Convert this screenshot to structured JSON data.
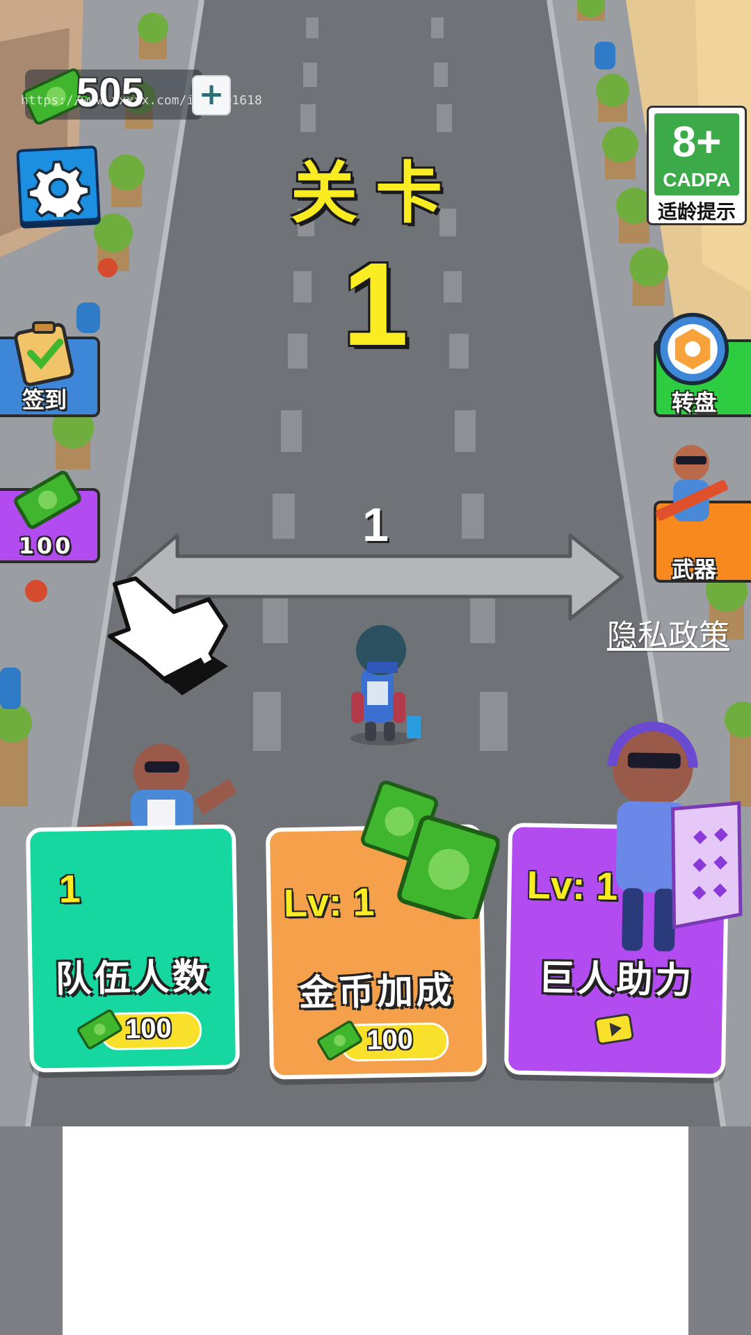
{
  "hud": {
    "cash_amount": "505",
    "watermark": "https://www.xxxxx.com/ishop01618"
  },
  "age_rating": {
    "age": "8+",
    "org": "CADPA",
    "note": "适龄提示"
  },
  "level": {
    "title": "关卡",
    "number": "1"
  },
  "left_menu": {
    "signin_label": "签到",
    "cash_reward": "100"
  },
  "right_menu": {
    "wheel_label": "转盘",
    "weapon_label": "武器"
  },
  "privacy_link": "隐私政策",
  "drag_hint": {
    "count": "1"
  },
  "upgrades": {
    "team": {
      "level": "1",
      "title": "队伍人数",
      "price": "100"
    },
    "coins": {
      "level": "Lv: 1",
      "title": "金币加成",
      "price": "100"
    },
    "giant": {
      "level": "Lv: 1",
      "title": "巨人助力",
      "price_icon": "video-ad-icon"
    }
  },
  "colors": {
    "title_yellow": "#f9ec22",
    "team_card": "#16d7a0",
    "coins_card": "#f5a04a",
    "giant_card": "#b24cf0",
    "cadpa_green": "#3daa4a",
    "settings_blue": "#1c8fe0"
  }
}
